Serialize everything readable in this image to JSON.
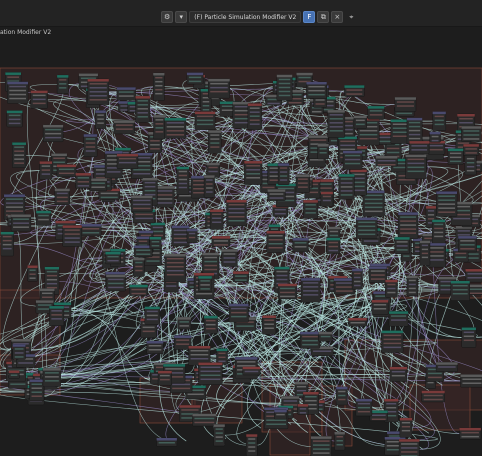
{
  "header": {
    "tree_name": "(F) Particle Simulation Modifier V2",
    "fake_user_label": "F",
    "close_label": "×",
    "pin_label": "⌖"
  },
  "breadcrumb": "ation Modifier V2",
  "colors": {
    "background": "#1d1d1d",
    "frame": "#3a2626",
    "frame_border": "#8a4a3a",
    "node_body": "#2b2b2b",
    "node_header_geometry": "#1f6e5e",
    "node_header_math": "#4a4a6e",
    "node_header_attribute": "#7a3a3a",
    "noodle": "#b9e6e1"
  },
  "icons": [
    "node-editor-icon",
    "node-tree-selector-icon",
    "fake-user-icon",
    "duplicate-icon",
    "close-icon",
    "pin-icon"
  ]
}
